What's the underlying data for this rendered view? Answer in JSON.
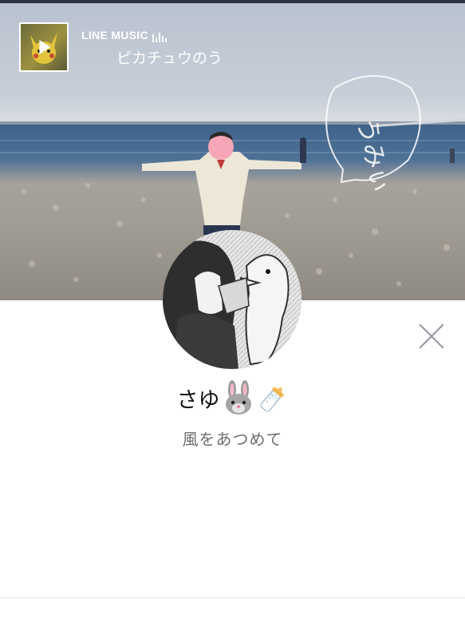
{
  "music": {
    "service_label": "LINE MUSIC",
    "equalizer_icon": "equalizer-icon",
    "song_title": "ピカチュウのう",
    "play_icon": "play-icon"
  },
  "profile": {
    "name": "さゆ",
    "name_emojis": [
      "rabbit-face-emoji",
      "baby-bottle-emoji"
    ],
    "status_message": "風をあつめて",
    "cover_doodle_text": "うみぃ"
  },
  "controls": {
    "close_icon": "close-icon"
  },
  "colors": {
    "status_text": "#6e6e6e",
    "close_icon": "#8e949b",
    "background": "#ffffff"
  }
}
